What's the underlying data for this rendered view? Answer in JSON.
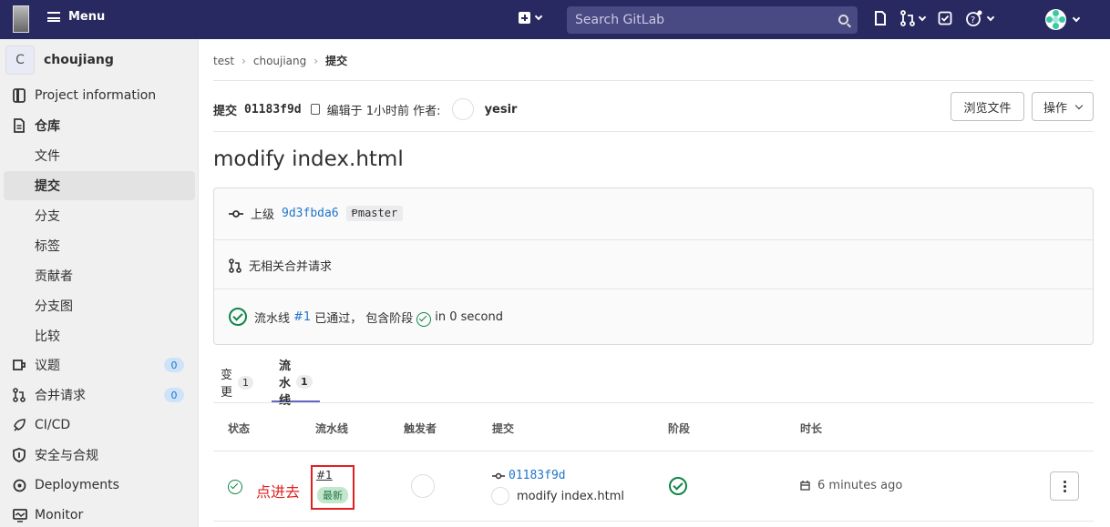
{
  "topbar": {
    "menu_label": "Menu",
    "search_placeholder": "Search GitLab"
  },
  "sidebar": {
    "project_initial": "C",
    "project_name": "choujiang",
    "items": [
      {
        "label": "Project information",
        "icon": "info-icon"
      },
      {
        "label": "仓库",
        "icon": "repository-icon"
      },
      {
        "label": "文件"
      },
      {
        "label": "提交"
      },
      {
        "label": "分支"
      },
      {
        "label": "标签"
      },
      {
        "label": "贡献者"
      },
      {
        "label": "分支图"
      },
      {
        "label": "比较"
      },
      {
        "label": "议题",
        "icon": "issues-icon",
        "badge": "0"
      },
      {
        "label": "合并请求",
        "icon": "merge-request-icon",
        "badge": "0"
      },
      {
        "label": "CI/CD",
        "icon": "rocket-icon"
      },
      {
        "label": "安全与合规",
        "icon": "shield-icon"
      },
      {
        "label": "Deployments",
        "icon": "deployments-icon"
      },
      {
        "label": "Monitor",
        "icon": "monitor-icon"
      }
    ]
  },
  "breadcrumb": [
    "test",
    "choujiang",
    "提交"
  ],
  "commit_header": {
    "label": "提交",
    "sha": "01183f9d",
    "edited": "编辑于 1小时前 作者:",
    "author": "yesir",
    "browse_button": "浏览文件",
    "actions_button": "操作"
  },
  "title": "modify index.html",
  "info": {
    "parent_label": "上级",
    "parent_sha": "9d3fbda6",
    "branch": "master",
    "mr_text": "无相关合并请求",
    "pipeline_prefix": "流水线",
    "pipeline_id": "#1",
    "pipeline_status": "已通过，",
    "pipeline_stage_text": "包含阶段",
    "pipeline_duration": "in 0 second"
  },
  "tabs": [
    {
      "label": "变更",
      "count": "1"
    },
    {
      "label": "流水线",
      "count": "1"
    }
  ],
  "table": {
    "headers": [
      "状态",
      "流水线",
      "触发者",
      "提交",
      "阶段",
      "时长"
    ],
    "row": {
      "annotation": "点进去",
      "pipeline_id": "#1",
      "badge": "最新",
      "commit_sha": "01183f9d",
      "commit_title": "modify index.html",
      "duration": "6 minutes ago"
    }
  },
  "colors": {
    "topbar": "#292961",
    "success": "#108548",
    "link": "#1f75cb",
    "annotation": "#e02020"
  }
}
